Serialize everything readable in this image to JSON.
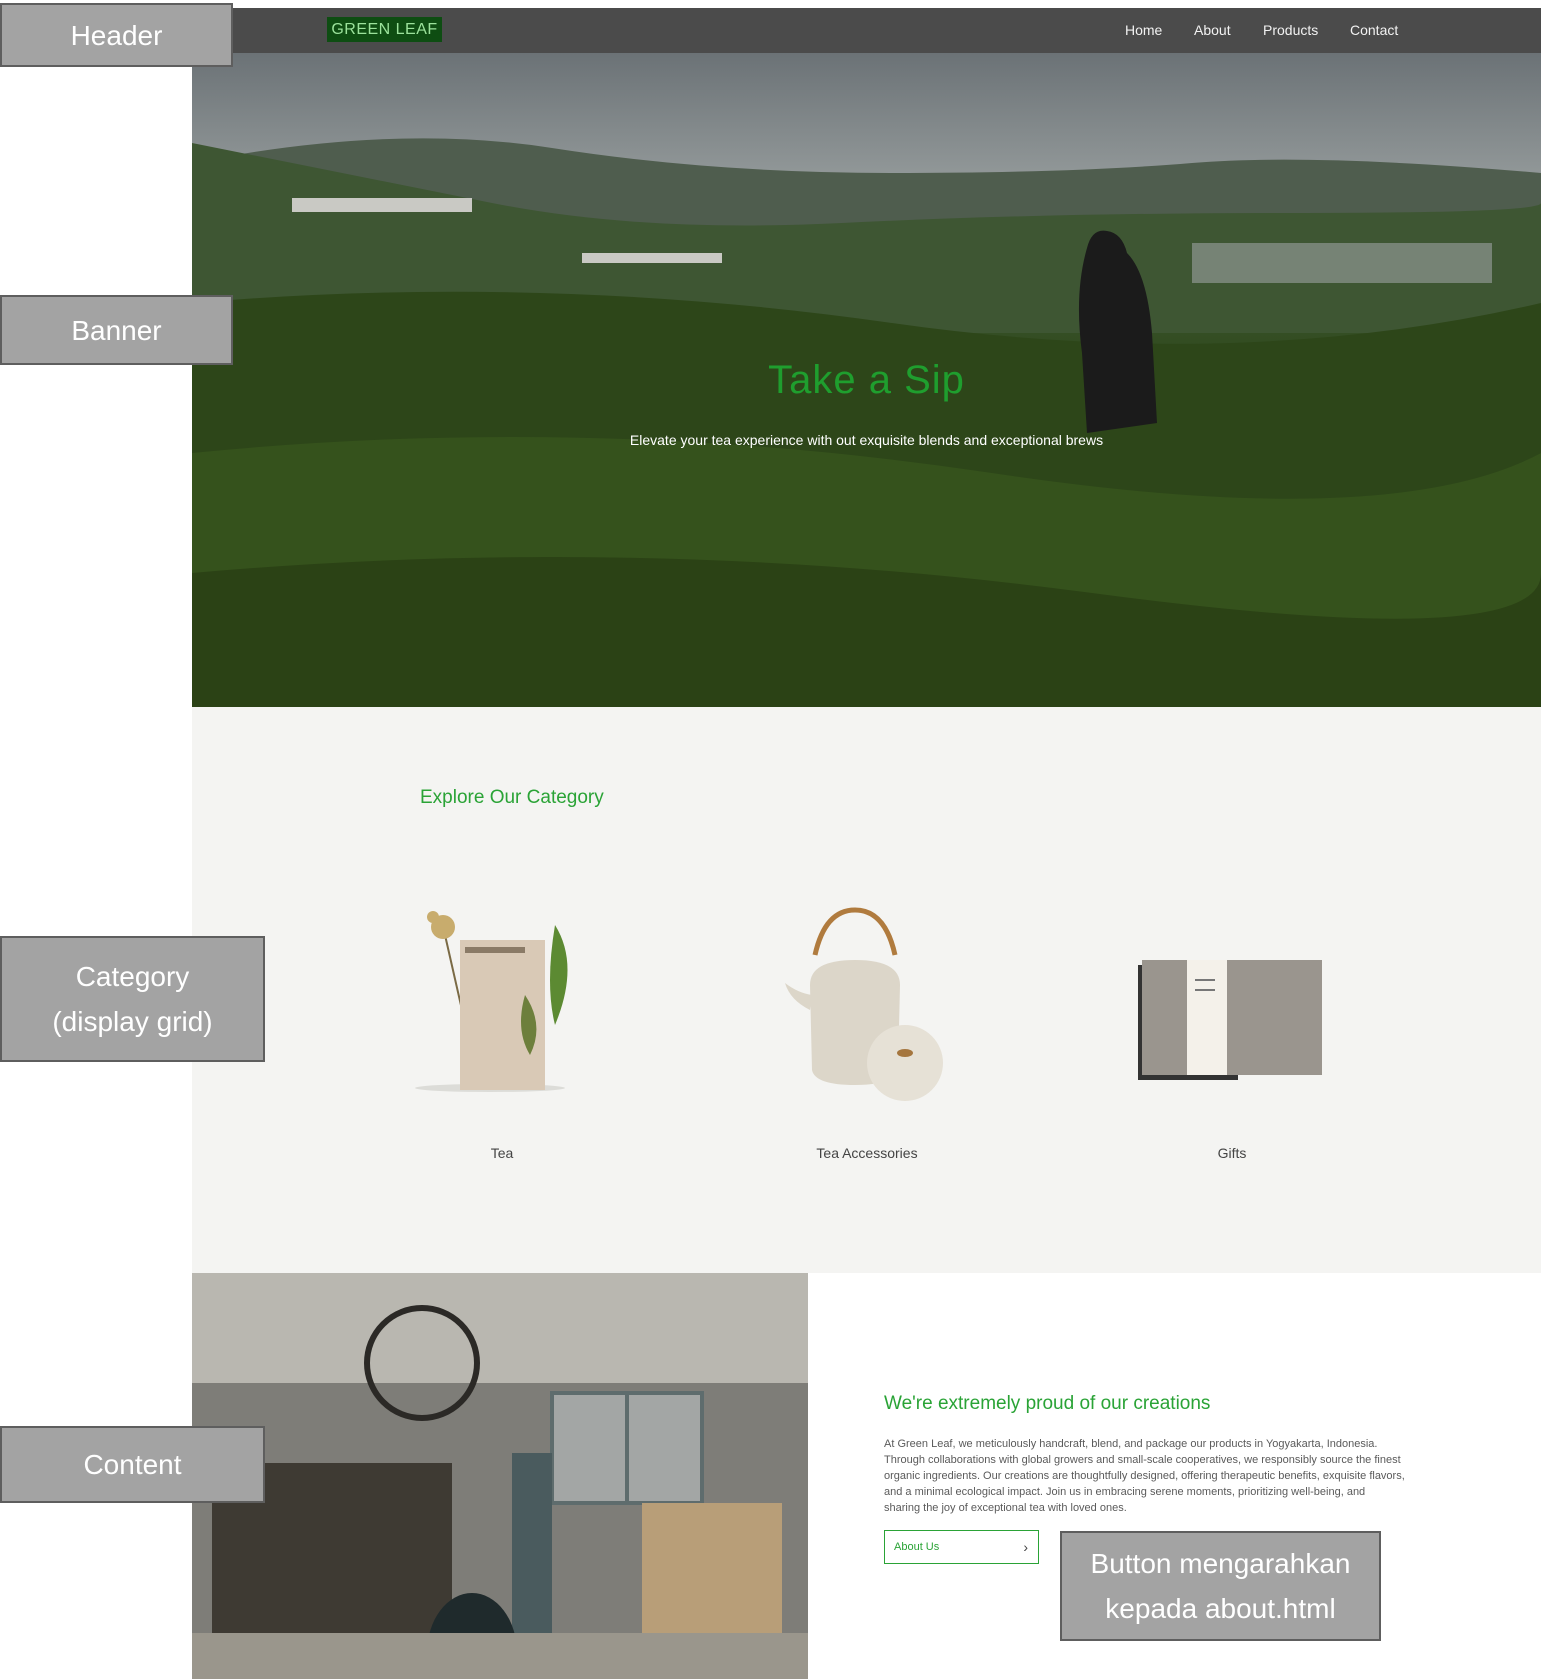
{
  "header": {
    "logo": "GREEN LEAF",
    "nav": [
      "Home",
      "About",
      "Products",
      "Contact"
    ]
  },
  "banner": {
    "title": "Take a Sip",
    "subtitle": "Elevate your tea experience with out exquisite blends and exceptional brews"
  },
  "category": {
    "title": "Explore Our Category",
    "items": [
      {
        "label": "Tea",
        "icon": "tea-box-image"
      },
      {
        "label": "Tea Accessories",
        "icon": "teapot-image"
      },
      {
        "label": "Gifts",
        "icon": "gift-box-image"
      }
    ]
  },
  "content": {
    "title": "We're extremely proud of our creations",
    "lines": [
      "At Green Leaf, we meticulously handcraft, blend, and package our products in Yogyakarta, Indonesia.",
      "Through collaborations with global growers and small-scale cooperatives, we responsibly source the finest",
      "organic ingredients. Our creations are thoughtfully designed, offering therapeutic benefits, exquisite flavors,",
      "and a minimal ecological impact. Join us in embracing serene moments, prioritizing well-being, and",
      "sharing the joy of exceptional tea with loved ones."
    ],
    "button_label": "About Us",
    "button_icon": "chevron-right-icon"
  },
  "annotations": {
    "header": "Header",
    "banner": "Banner",
    "category": [
      "Category",
      "(display grid)"
    ],
    "content": "Content",
    "button": [
      "Button mengarahkan",
      "kepada about.html"
    ]
  },
  "colors": {
    "accent": "#2aa336",
    "header_bg": "#4b4b4b",
    "logo_bg": "#0e4d12",
    "section_bg": "#f4f4f2",
    "annotation_bg": "#a3a3a3"
  }
}
